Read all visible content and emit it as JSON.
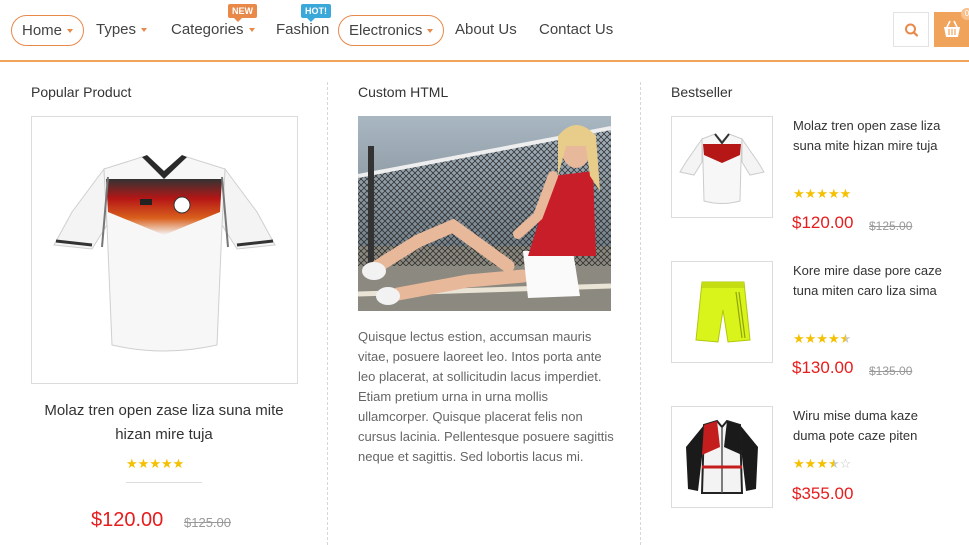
{
  "nav": {
    "home": "Home",
    "types": "Types",
    "categories": "Categories",
    "fashion": "Fashion",
    "electronics": "Electronics",
    "about": "About Us",
    "contact": "Contact Us",
    "badge_new": "NEW",
    "badge_hot": "HOT!",
    "cart_count": "0",
    "colors": {
      "accent": "#e8894a",
      "new_badge": "#e8894a",
      "hot_badge": "#3aa8d8",
      "cart": "#f0a35a"
    }
  },
  "popular": {
    "title": "Popular Product",
    "product_name": "Molaz tren open zase liza suna mite hizan mire tuja",
    "rating": 5,
    "price": "$120.00",
    "old_price": "$125.00"
  },
  "custom": {
    "title": "Custom HTML",
    "text": "Quisque lectus estion, accumsan mauris vitae, posuere laoreet leo. Intos porta ante leo placerat, at sollicitudin lacus imperdiet. Etiam pretium urna in urna mollis ullamcorper. Quisque placerat felis non cursus lacinia. Pellentesque posuere sagittis neque et sagittis. Sed lobortis lacus mi."
  },
  "bestseller": {
    "title": "Bestseller",
    "items": [
      {
        "name": "Molaz tren open zase liza suna mite hizan mire tuja",
        "rating": 5,
        "price": "$120.00",
        "old_price": "$125.00",
        "image": "jersey-image"
      },
      {
        "name": "Kore mire dase pore caze tuna miten caro liza sima",
        "rating": 4.5,
        "price": "$130.00",
        "old_price": "$135.00",
        "image": "shorts-image"
      },
      {
        "name": "Wiru mise duma kaze duma pote caze piten",
        "rating": 3.5,
        "price": "$355.00",
        "old_price": "",
        "image": "jacket-image"
      }
    ]
  },
  "colors": {
    "price": "#e61d1d",
    "star": "#f4c000"
  }
}
